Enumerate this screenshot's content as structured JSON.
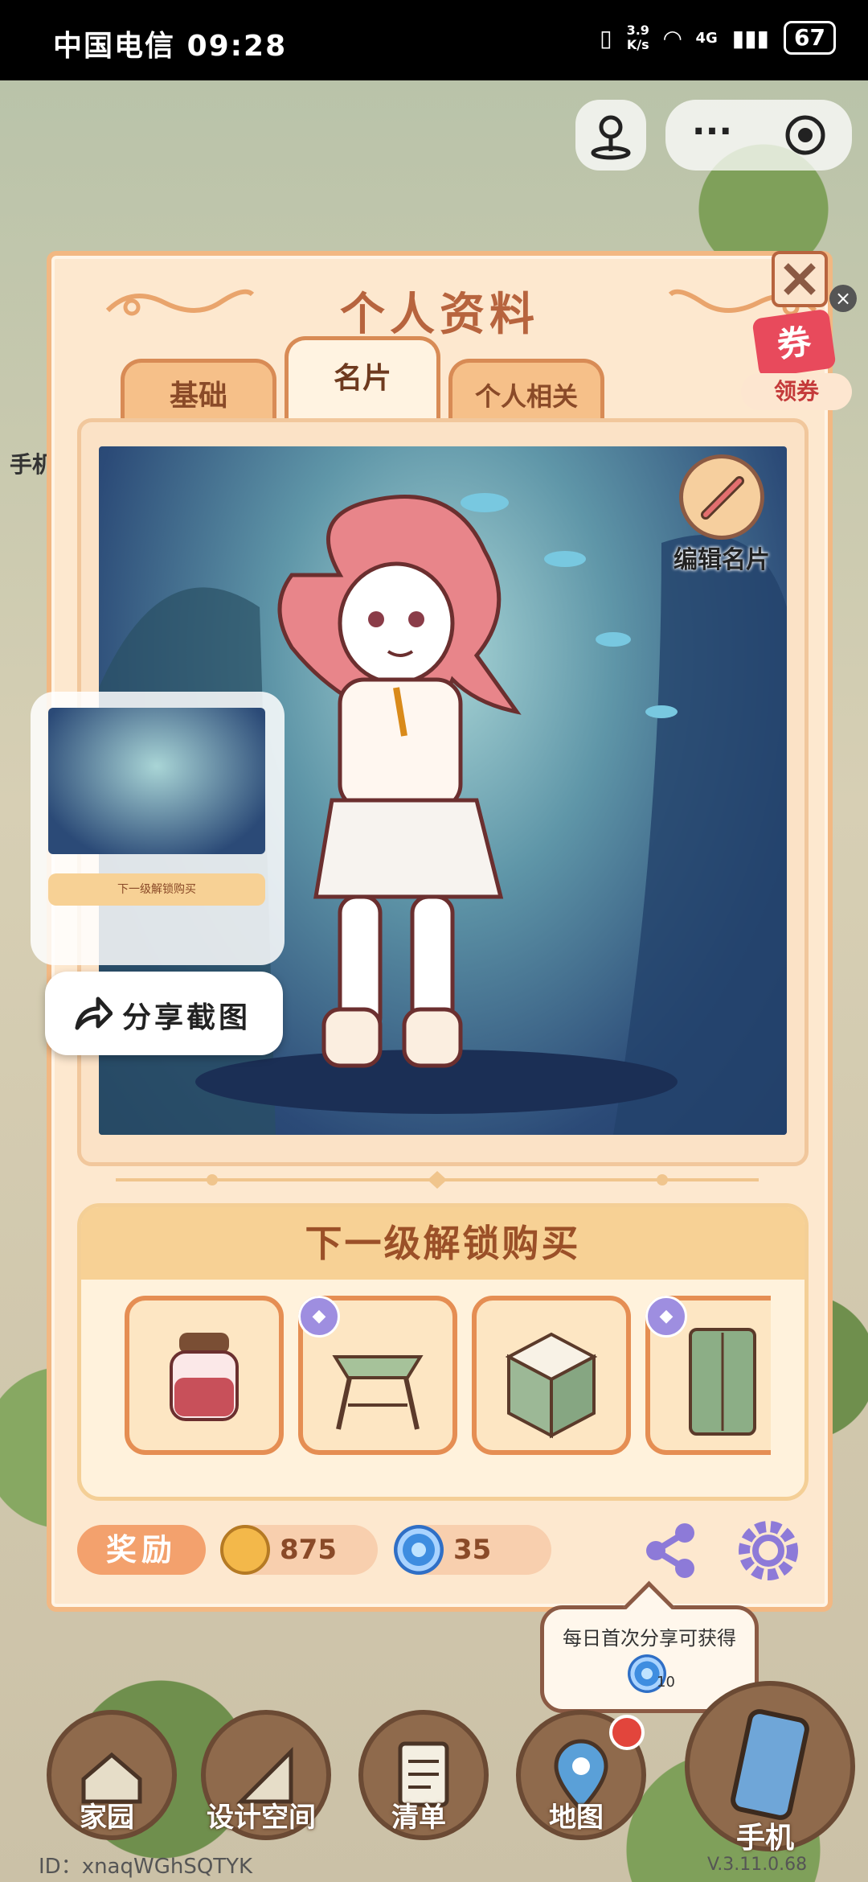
{
  "status_bar": {
    "carrier": "中国电信",
    "time": "09:28",
    "net_speed_value": "3.9",
    "net_speed_unit": "K/s",
    "network": "4G",
    "battery": "67"
  },
  "panel": {
    "title": "个人资料",
    "tabs": [
      {
        "label": "基础"
      },
      {
        "label": "名片",
        "active": true
      },
      {
        "label": "个人相关"
      }
    ],
    "edit_card_label": "编辑名片",
    "unlock_title": "下一级解锁购买",
    "reward_label": "奖励",
    "gold_amount": "875",
    "gem_amount": "35"
  },
  "coupon": {
    "icon_text": "券",
    "label": "领券"
  },
  "share_screenshot": {
    "label": "分享截图",
    "thumb_caption": "下一级解锁购买"
  },
  "tooltip": {
    "text": "每日首次分享可获得",
    "amount": "10"
  },
  "nav": [
    {
      "label": "家园"
    },
    {
      "label": "设计空间"
    },
    {
      "label": "清单"
    },
    {
      "label": "地图"
    },
    {
      "label": "手机"
    }
  ],
  "footer": {
    "user_id": "ID：xnaqWGhSQTYK",
    "version": "V.3.11.0.68"
  },
  "side_label": "手机",
  "colors": {
    "accent": "#b7643e",
    "panel_bg": "#fde8cf",
    "panel_border": "#f2b883"
  }
}
